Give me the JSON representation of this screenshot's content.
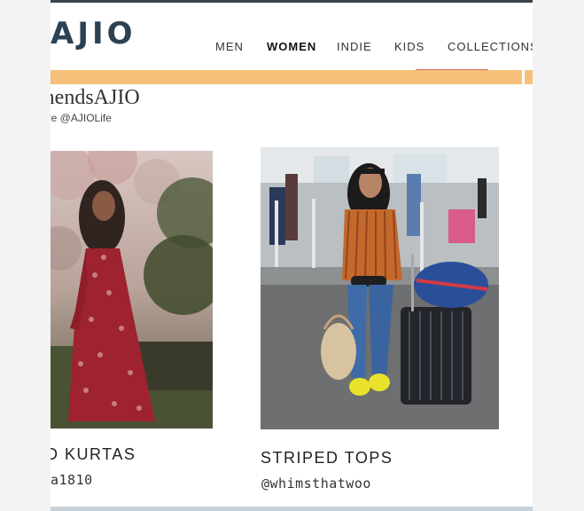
{
  "header": {
    "logo": "AJIO",
    "nav": [
      {
        "label": "MEN",
        "active": false
      },
      {
        "label": "WOMEN",
        "active": true
      },
      {
        "label": "INDIE",
        "active": false
      },
      {
        "label": "KIDS",
        "active": false
      },
      {
        "label": "COLLECTIONS",
        "active": false
      }
    ]
  },
  "section": {
    "hashtag": "mendsAJIO",
    "subline": "ove @AJIOLife"
  },
  "cards": [
    {
      "title": "D KURTAS",
      "handle": "a1810",
      "image": "woman-in-red-dress-photo"
    },
    {
      "title": "STRIPED TOPS",
      "handle": "@whimsthatwoo",
      "image": "woman-with-luggage-photo"
    }
  ],
  "colors": {
    "brand": "#2c4152",
    "banner": "#f6c07a",
    "banner_tab": "#d46a5a"
  }
}
